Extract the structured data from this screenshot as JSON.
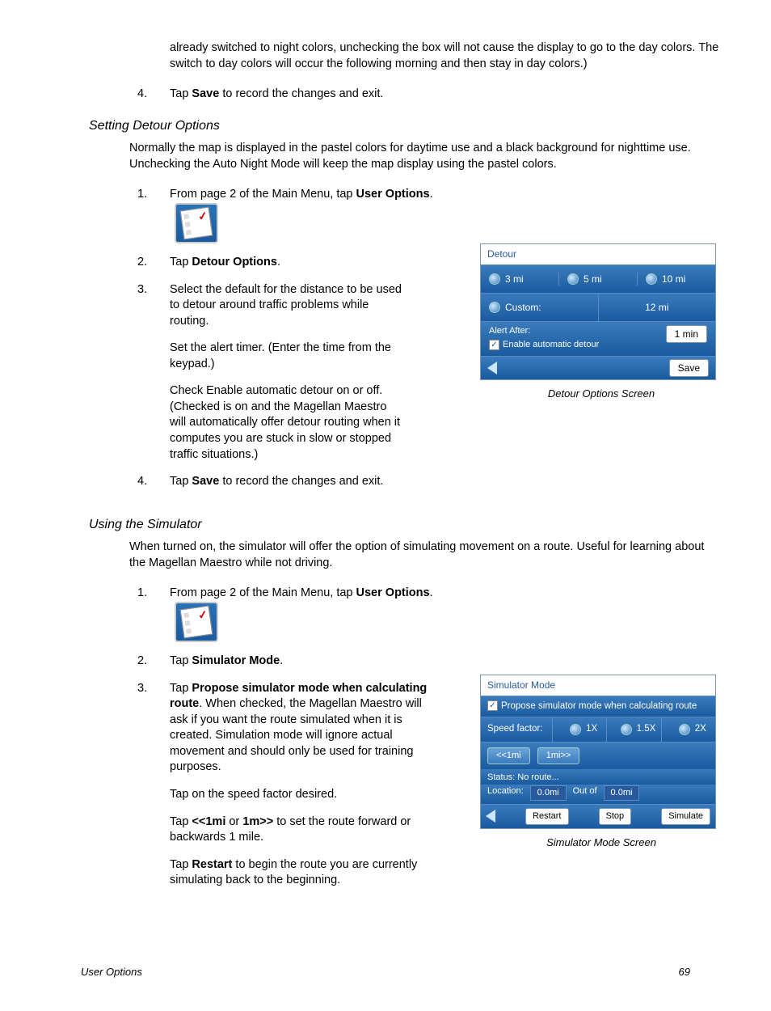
{
  "intro_continued": "already switched to night colors, unchecking the box will not cause the display to go to the day colors.  The switch to day colors will occur the following morning and then stay in day colors.)",
  "step4a_prefix": "Tap ",
  "step4a_bold": "Save",
  "step4a_suffix": " to record the changes and exit.",
  "section1_heading": "Setting Detour Options",
  "section1_intro": "Normally the map is displayed in the pastel colors for daytime use and a black background for nighttime use.  Unchecking the Auto Night Mode will keep the map display using the pastel colors.",
  "s1_step1_prefix": "From page 2 of the Main Menu, tap ",
  "s1_step1_bold": "User Options",
  "s1_step1_suffix": ".",
  "s1_step2_prefix": "Tap ",
  "s1_step2_bold": "Detour Options",
  "s1_step2_suffix": ".",
  "s1_step3_p1": "Select the default for the distance to be used to detour around traffic problems while routing.",
  "s1_step3_p2": "Set the alert timer.  (Enter the time from the keypad.)",
  "s1_step3_p3": "Check Enable automatic detour on or off.  (Checked is on and the Magellan Maestro will automatically offer detour routing when it computes you are stuck in slow or stopped traffic situations.)",
  "s1_step4_prefix": "Tap ",
  "s1_step4_bold": "Save",
  "s1_step4_suffix": " to record the changes and exit.",
  "detour_caption": "Detour Options Screen",
  "detour_shot": {
    "title": "Detour",
    "opt1": "3 mi",
    "opt2": "5 mi",
    "opt3": "10 mi",
    "custom_label": "Custom:",
    "custom_value": "12 mi",
    "alert_label": "Alert After:",
    "enable_label": "Enable automatic detour",
    "one_min": "1 min",
    "save": "Save"
  },
  "section2_heading": "Using the Simulator",
  "section2_intro": "When turned on, the simulator will offer the option of simulating movement on a route.  Useful for learning about the Magellan Maestro while not driving.",
  "s2_step1_prefix": "From page 2 of the Main Menu, tap ",
  "s2_step1_bold": "User Options",
  "s2_step1_suffix": ".",
  "s2_step2_prefix": "Tap ",
  "s2_step2_bold": "Simulator Mode",
  "s2_step2_suffix": ".",
  "s2_step3_prefix": "Tap ",
  "s2_step3_bold": "Propose simulator mode when calculating route",
  "s2_step3_suffix": ".  When checked, the Magellan Maestro will ask if you want the route simulated when it is created.  Simulation mode will ignore actual movement and should only be used for training purposes.",
  "s2_step3_p2": "Tap on the speed factor desired.",
  "s2_step3_p3_prefix": "Tap ",
  "s2_step3_p3_bold1": "<<1mi",
  "s2_step3_p3_mid": " or ",
  "s2_step3_p3_bold2": "1m>>",
  "s2_step3_p3_suffix": " to set the route forward or backwards 1 mile.",
  "s2_step3_p4_prefix": "Tap ",
  "s2_step3_p4_bold": "Restart",
  "s2_step3_p4_suffix": " to begin the route you are currently simulating back to the beginning.",
  "sim_caption": "Simulator Mode Screen",
  "sim_shot": {
    "title": "Simulator Mode",
    "propose": "Propose simulator mode when calculating route",
    "speed_label": "Speed factor:",
    "sp1": "1X",
    "sp2": "1.5X",
    "sp3": "2X",
    "back1": "<<1mi",
    "fwd1": "1mi>>",
    "status": "Status: No route...",
    "loc_label": "Location:",
    "loc1": "0.0mi",
    "outof": "Out of",
    "loc2": "0.0mi",
    "restart": "Restart",
    "stop": "Stop",
    "simulate": "Simulate"
  },
  "footer_left": "User Options",
  "footer_right": "69"
}
